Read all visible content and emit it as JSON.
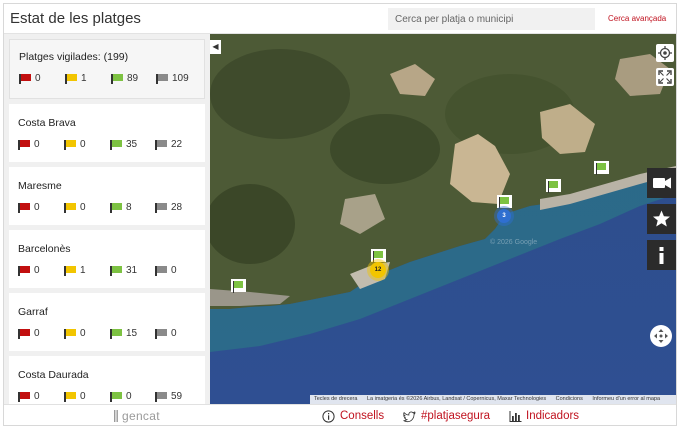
{
  "header": {
    "title": "Estat de les platges",
    "search_placeholder": "Cerca per platja o municipi",
    "advanced_search": "Cerca avançada"
  },
  "flag_colors": {
    "red": "#c20f0f",
    "yellow": "#f2c500",
    "green": "#7dc242",
    "gray": "#8a8a8a"
  },
  "regions": [
    {
      "name": "Platges vigilades: (199)",
      "red": "0",
      "yellow": "1",
      "green": "89",
      "gray": "109"
    },
    {
      "name": "Costa Brava",
      "red": "0",
      "yellow": "0",
      "green": "35",
      "gray": "22"
    },
    {
      "name": "Maresme",
      "red": "0",
      "yellow": "0",
      "green": "8",
      "gray": "28"
    },
    {
      "name": "Barcelonès",
      "red": "0",
      "yellow": "1",
      "green": "31",
      "gray": "0"
    },
    {
      "name": "Garraf",
      "red": "0",
      "yellow": "0",
      "green": "15",
      "gray": "0"
    },
    {
      "name": "Costa Daurada",
      "red": "0",
      "yellow": "0",
      "green": "0",
      "gray": "59"
    }
  ],
  "map": {
    "clusters": {
      "blue": "3",
      "yellow": "12"
    },
    "watermark": "© 2026 Google",
    "attribution": {
      "shortcuts": "Tecles de drecera",
      "imagery": "La imatgeria és ©2026 Airbus, Landsat / Copernicus, Maxar Technologies",
      "terms": "Condicions",
      "report": "Informeu d'un error al mapa"
    }
  },
  "footer": {
    "logo": "gencat",
    "advice": "Consells",
    "hashtag": "#platjasegura",
    "indicators": "Indicadors"
  }
}
